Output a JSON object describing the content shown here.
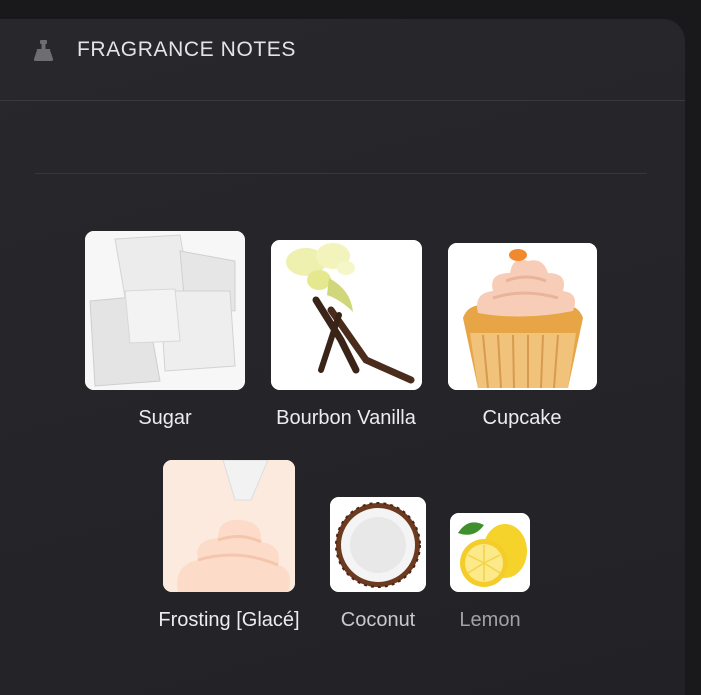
{
  "header": {
    "title": "FRAGRANCE NOTES",
    "icon": "perfume-flask-icon"
  },
  "notes": [
    {
      "label": "Sugar",
      "icon": "sugar-cubes-image"
    },
    {
      "label": "Bourbon Vanilla",
      "icon": "vanilla-flower-image"
    },
    {
      "label": "Cupcake",
      "icon": "cupcake-image"
    },
    {
      "label": "Frosting [Glacé]",
      "icon": "frosting-image"
    },
    {
      "label": "Coconut",
      "icon": "coconut-image"
    },
    {
      "label": "Lemon",
      "icon": "lemon-image"
    }
  ],
  "colors": {
    "page_bg": "#19191b",
    "panel_bg": "#27272b",
    "title_text": "#e4e4e6",
    "label_text": "#ececee"
  }
}
